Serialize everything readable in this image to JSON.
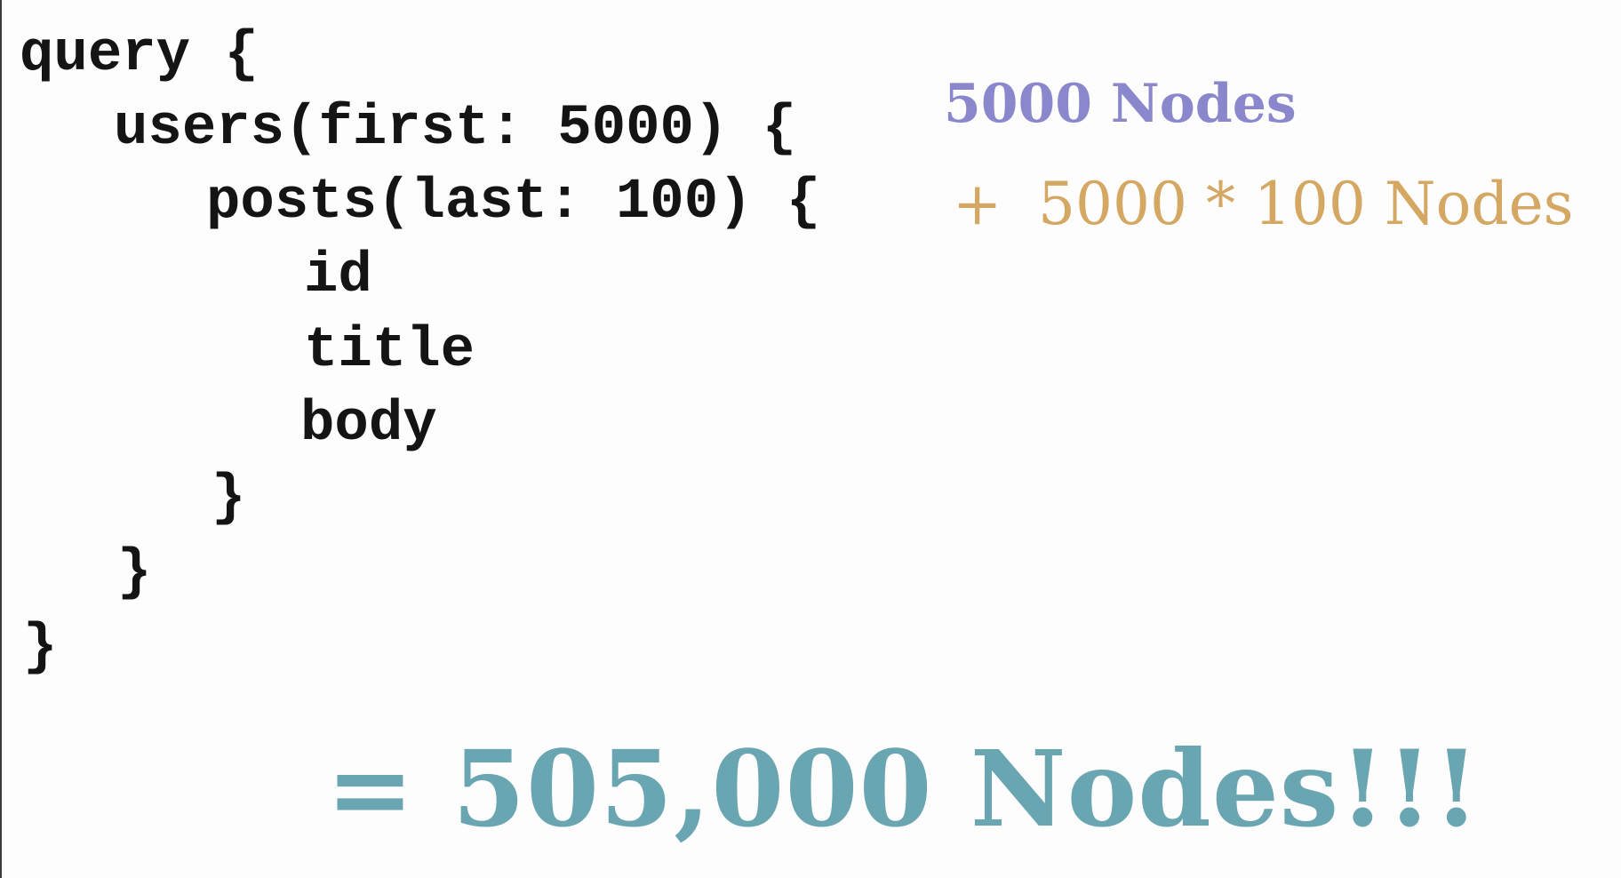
{
  "code": {
    "lines": [
      "query {",
      "users(first: 5000) {",
      "posts(last: 100) {",
      "id",
      "title",
      "body",
      "}",
      "}",
      "}"
    ]
  },
  "annotations": {
    "users_nodes": "5000 Nodes",
    "posts_plus": "+",
    "posts_nodes": "5000 * 100 Nodes",
    "total": "= 505,000 Nodes!!!"
  },
  "colors": {
    "code_text": "#141414",
    "users_nodes": "#8a87cc",
    "posts_nodes": "#d4a763",
    "total": "#6aa6b2",
    "background": "#fdfdfd"
  }
}
